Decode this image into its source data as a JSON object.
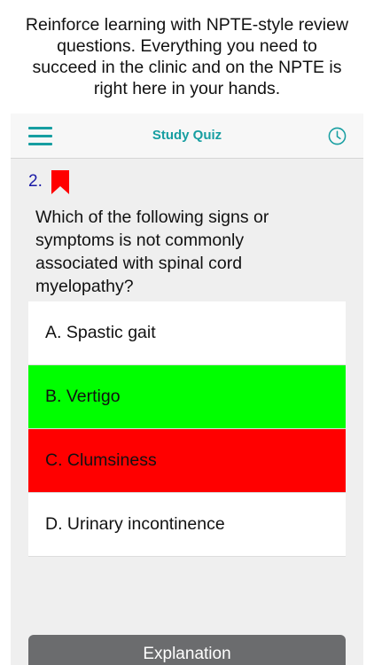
{
  "promo": {
    "text": "Reinforce learning with NPTE-style review questions. Everything you need to succeed in the clinic and on the NPTE is right here in your hands."
  },
  "navbar": {
    "title": "Study Quiz",
    "menu_icon": "hamburger-menu-icon",
    "clock_icon": "clock-icon"
  },
  "question": {
    "number": "2.",
    "bookmark_icon": "bookmark-icon",
    "text": "Which of the following signs or symptoms is not commonly associated with spinal cord myelopathy?"
  },
  "answers": [
    {
      "label": "A. Spastic gait",
      "state": "neutral"
    },
    {
      "label": "B. Vertigo",
      "state": "correct"
    },
    {
      "label": "C. Clumsiness",
      "state": "incorrect"
    },
    {
      "label": "D. Urinary incontinence",
      "state": "neutral"
    }
  ],
  "explanation_button": "Explanation",
  "colors": {
    "accent": "#169ea1",
    "correct": "#00ff00",
    "incorrect": "#ff0000",
    "question_number": "#1a1aa6",
    "bookmark": "#ff0000",
    "button": "#6b6c6e"
  }
}
